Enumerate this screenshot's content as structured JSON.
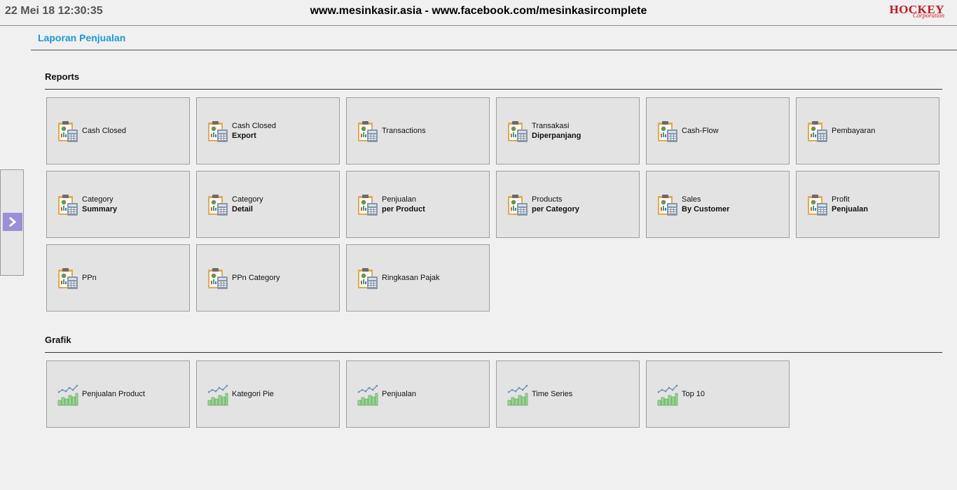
{
  "header": {
    "datetime": "22 Mei 18 12:30:35",
    "site": "www.mesinkasir.asia - www.facebook.com/mesinkasircomplete",
    "logo_brand": "HOCKEY",
    "logo_sub": "Corporation"
  },
  "page": {
    "title": "Laporan Penjualan"
  },
  "reports": {
    "title": "Reports",
    "items": [
      {
        "l1": "Cash Closed",
        "l2": ""
      },
      {
        "l1": "Cash Closed",
        "l2": "Export"
      },
      {
        "l1": "Transactions",
        "l2": ""
      },
      {
        "l1": "Transakasi",
        "l2": "Diperpanjang"
      },
      {
        "l1": "Cash-Flow",
        "l2": ""
      },
      {
        "l1": "Pembayaran",
        "l2": ""
      },
      {
        "l1": "Category",
        "l2": "Summary"
      },
      {
        "l1": "Category",
        "l2": "Detail"
      },
      {
        "l1": "Penjualan",
        "l2": "per Product"
      },
      {
        "l1": "Products",
        "l2": "per Category"
      },
      {
        "l1": "Sales",
        "l2": "By Customer"
      },
      {
        "l1": "Profit",
        "l2": "Penjualan"
      },
      {
        "l1": "PPn",
        "l2": ""
      },
      {
        "l1": "PPn Category",
        "l2": ""
      },
      {
        "l1": "Ringkasan Pajak",
        "l2": ""
      }
    ]
  },
  "grafik": {
    "title": "Grafik",
    "items": [
      {
        "l1": "Penjualan Product"
      },
      {
        "l1": "Kategori Pie"
      },
      {
        "l1": "Penjualan"
      },
      {
        "l1": "Time Series"
      },
      {
        "l1": "Top 10"
      }
    ]
  },
  "icons": {
    "report": "report-clipboard-icon",
    "chart": "chart-icon",
    "toggle": "chevron-right-icon"
  },
  "colors": {
    "accent": "#1a9ad6",
    "logo": "#c8181e",
    "toggle": "#9a8fd8"
  }
}
